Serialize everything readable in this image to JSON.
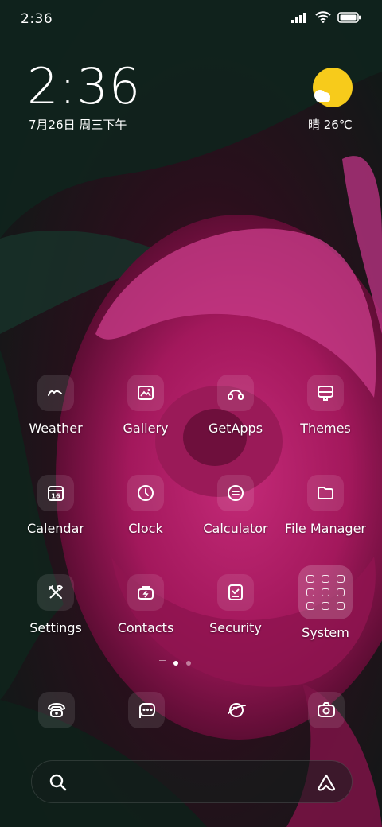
{
  "status_bar": {
    "time": "2:36",
    "icons": [
      "signal-icon",
      "wifi-icon",
      "battery-icon"
    ]
  },
  "clock_widget": {
    "time": "2:36",
    "date": "7月26日 周三下午"
  },
  "weather_widget": {
    "icon": "partly-sunny-icon",
    "text": "晴 26℃"
  },
  "apps": [
    {
      "name": "weather",
      "label": "Weather",
      "icon": "weather-icon"
    },
    {
      "name": "gallery",
      "label": "Gallery",
      "icon": "gallery-icon"
    },
    {
      "name": "getapps",
      "label": "GetApps",
      "icon": "getapps-icon"
    },
    {
      "name": "themes",
      "label": "Themes",
      "icon": "themes-icon"
    },
    {
      "name": "calendar",
      "label": "Calendar",
      "icon": "calendar-icon",
      "badge": "16"
    },
    {
      "name": "clock",
      "label": "Clock",
      "icon": "clock-icon"
    },
    {
      "name": "calculator",
      "label": "Calculator",
      "icon": "calculator-icon"
    },
    {
      "name": "file-manager",
      "label": "File Manager",
      "icon": "folder-icon"
    },
    {
      "name": "settings",
      "label": "Settings",
      "icon": "settings-icon"
    },
    {
      "name": "contacts",
      "label": "Contacts",
      "icon": "contacts-icon"
    },
    {
      "name": "security",
      "label": "Security",
      "icon": "security-icon"
    },
    {
      "name": "system",
      "label": "System",
      "icon": "system-folder-icon"
    }
  ],
  "page_indicator": {
    "pages": 2,
    "current": 1
  },
  "dock": [
    {
      "name": "phone",
      "icon": "phone-icon"
    },
    {
      "name": "messages",
      "icon": "messages-icon"
    },
    {
      "name": "browser",
      "icon": "browser-icon"
    },
    {
      "name": "camera",
      "icon": "camera-icon"
    }
  ],
  "search_bar": {
    "left_icon": "search-icon",
    "right_icon": "assistant-icon"
  },
  "colors": {
    "sun": "#F7CB1B",
    "rose": "#B8206E",
    "background": "#0F1F1A"
  }
}
